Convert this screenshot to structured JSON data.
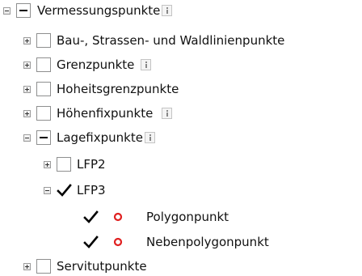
{
  "tree": {
    "root": {
      "label": "Vermessungspunkte",
      "state": "indeterminate",
      "expanded": true,
      "info_icon": "info-icon"
    },
    "children": [
      {
        "label": "Bau-, Strassen- und Waldlinienpunkte",
        "state": "unchecked",
        "expanded": false
      },
      {
        "label": "Grenzpunkte",
        "state": "unchecked",
        "expanded": false,
        "info_icon": "info-icon"
      },
      {
        "label": "Hoheitsgrenzpunkte",
        "state": "unchecked",
        "expanded": false
      },
      {
        "label": "Höhenfixpunkte",
        "state": "unchecked",
        "expanded": false,
        "info_icon": "info-icon"
      },
      {
        "label": "Lagefixpunkte",
        "state": "indeterminate",
        "expanded": true,
        "info_icon": "info-icon",
        "children": [
          {
            "label": "LFP2",
            "state": "unchecked",
            "expanded": false
          },
          {
            "label": "LFP3",
            "state": "checked",
            "expanded": true,
            "children": [
              {
                "label": "Polygonpunkt",
                "state": "checked",
                "symbol": "red-circle-icon",
                "symbol_color": "#e02020"
              },
              {
                "label": "Nebenpolygonpunkt",
                "state": "checked",
                "symbol": "red-circle-icon",
                "symbol_color": "#e02020"
              }
            ]
          }
        ]
      },
      {
        "label": "Servitutpunkte",
        "state": "unchecked",
        "expanded": false
      }
    ]
  }
}
